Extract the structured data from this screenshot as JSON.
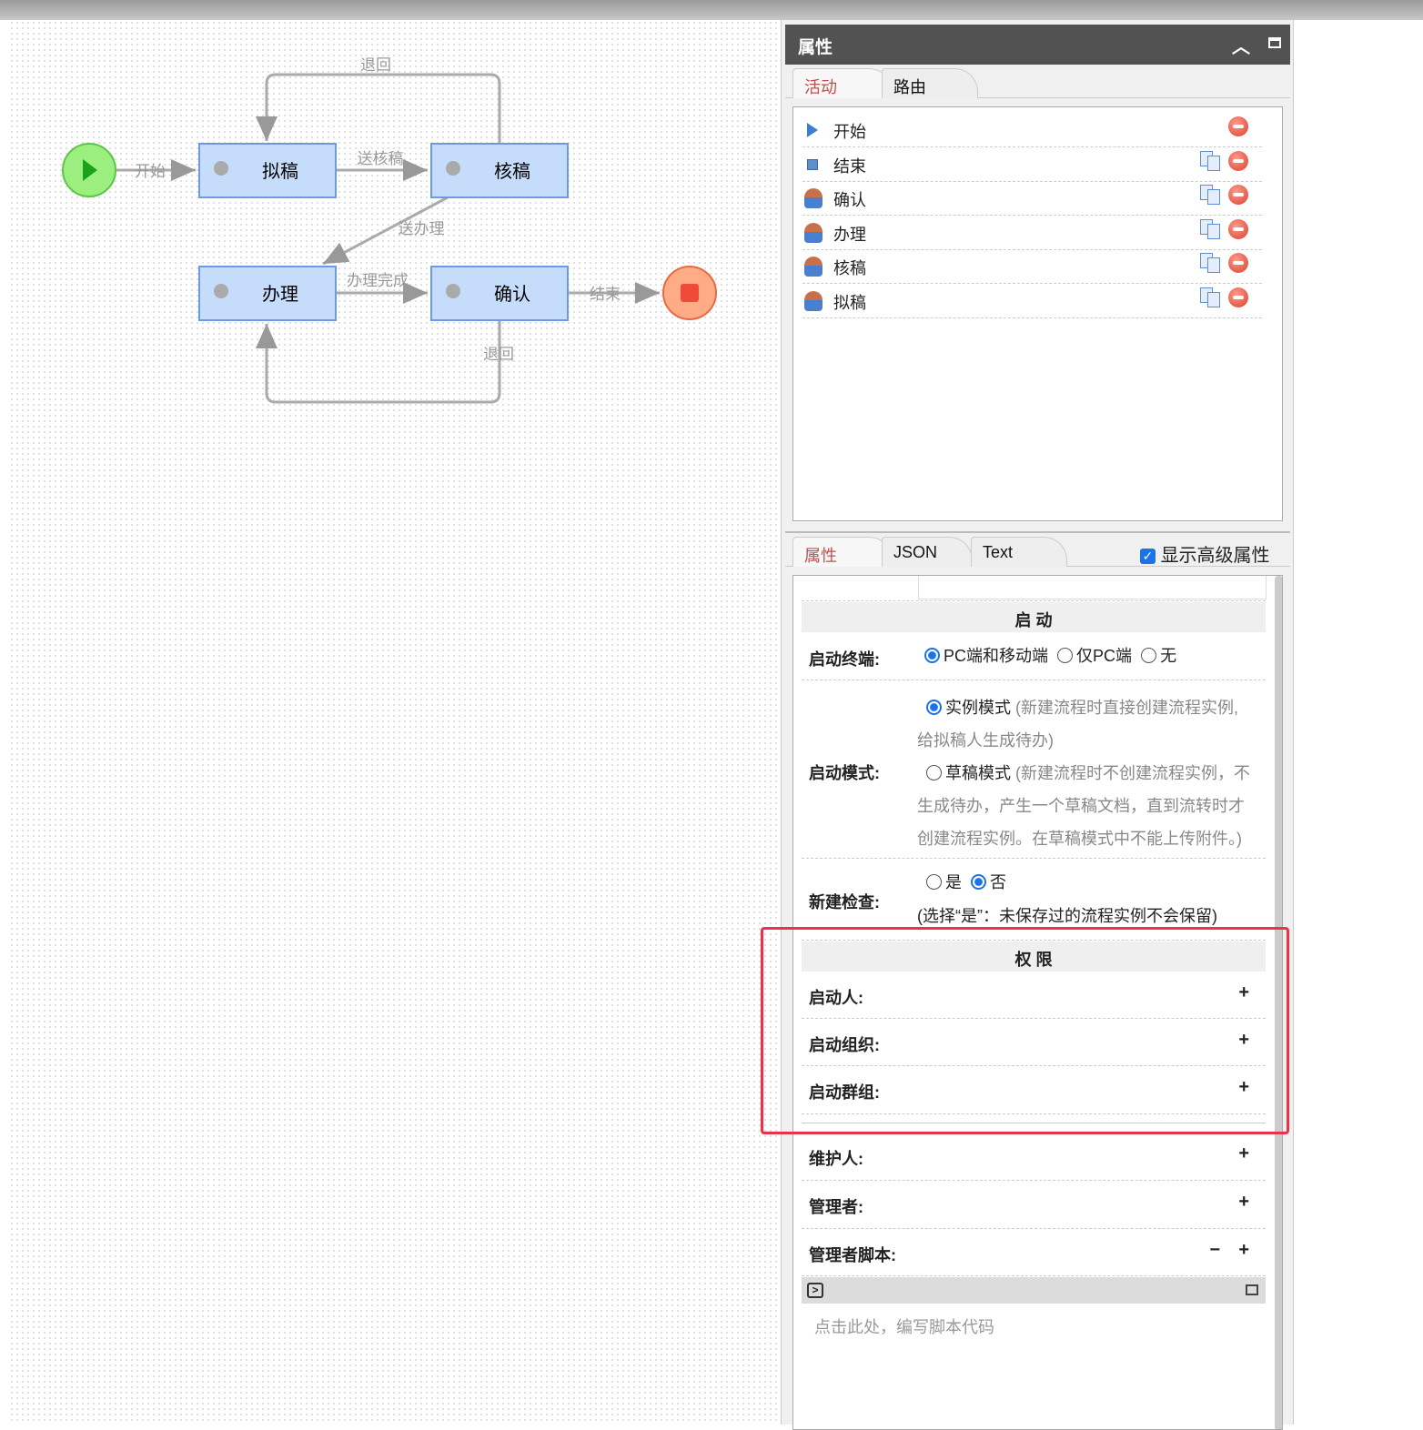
{
  "diagram": {
    "nodes": {
      "draft": "拟稿",
      "review": "核稿",
      "handle": "办理",
      "confirm": "确认"
    },
    "edges": {
      "start": "开始",
      "send_review": "送核稿",
      "back_top": "退回",
      "send_handle": "送办理",
      "handle_done": "办理完成",
      "end": "结束",
      "back_bottom": "退回"
    }
  },
  "panel": {
    "title": "属性",
    "tabs": [
      "活动",
      "路由"
    ],
    "activities": [
      {
        "label": "开始",
        "icon": "start-triangle-icon"
      },
      {
        "label": "结束",
        "icon": "end-square-icon"
      },
      {
        "label": "确认",
        "icon": "user-icon"
      },
      {
        "label": "办理",
        "icon": "user-icon"
      },
      {
        "label": "核稿",
        "icon": "user-icon"
      },
      {
        "label": "拟稿",
        "icon": "user-icon"
      }
    ],
    "prop_tabs": [
      "属性",
      "JSON",
      "Text"
    ],
    "show_advanced": "显示高级属性",
    "sections": {
      "start": "启 动",
      "terminal_label": "启动终端:",
      "terminal_options": [
        "PC端和移动端",
        "仅PC端",
        "无"
      ],
      "mode_label": "启动模式:",
      "mode_instance": "实例模式",
      "mode_instance_desc1": "(新建流程时直接创建流程实例,",
      "mode_instance_desc2": "给拟稿人生成待办)",
      "mode_draft": "草稿模式",
      "mode_draft_desc1": "(新建流程时不创建流程实例，不",
      "mode_draft_desc2": "生成待办，产生一个草稿文档，直到流转时才",
      "mode_draft_desc3": "创建流程实例。在草稿模式中不能上传附件。)",
      "check_label": "新建检查:",
      "check_yes": "是",
      "check_no": "否",
      "check_note": "(选择“是”：未保存过的流程实例不会保留)",
      "perm": "权 限",
      "starter": "启动人:",
      "start_org": "启动组织:",
      "start_group": "启动群组:",
      "maintainer": "维护人:",
      "manager": "管理者:",
      "manager_script": "管理者脚本:",
      "script_placeholder": "点击此处，编写脚本代码"
    }
  }
}
